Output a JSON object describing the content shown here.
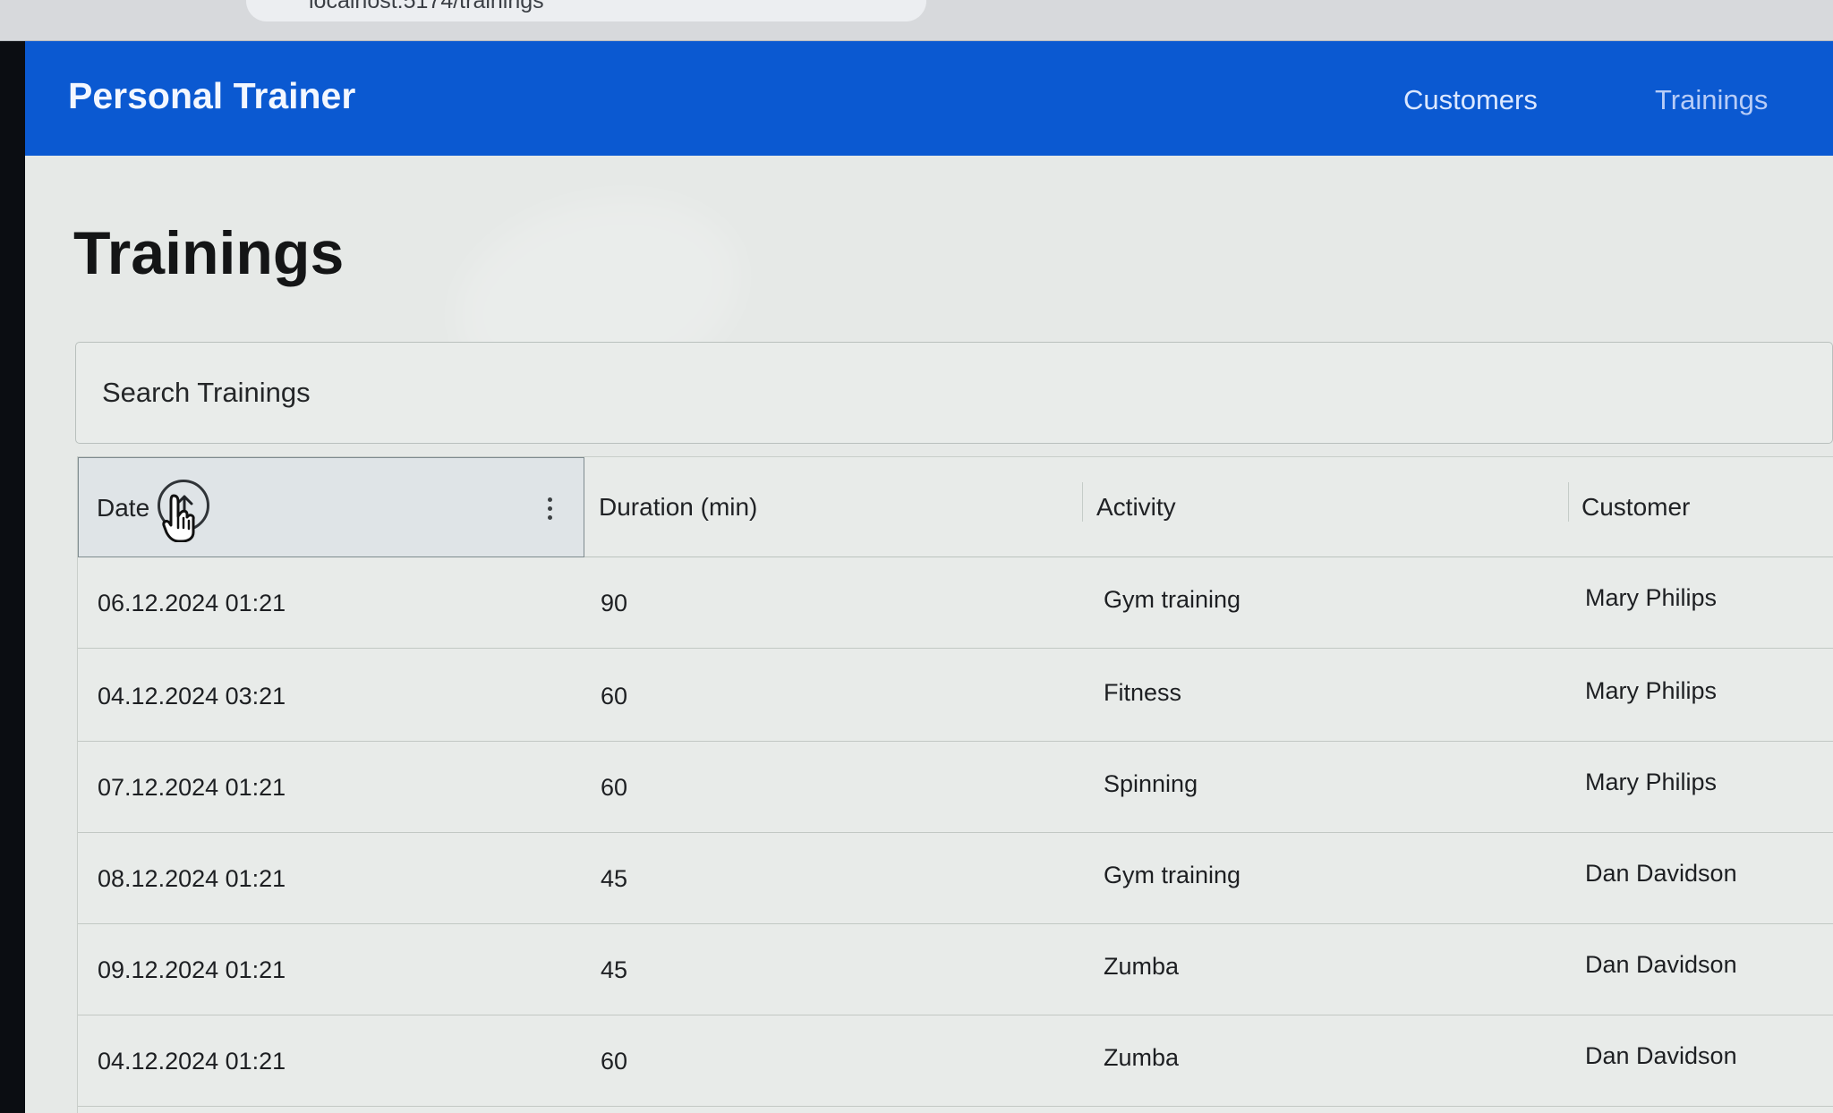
{
  "browser": {
    "url_fragment": "localhost:5174/trainings"
  },
  "topbar": {
    "brand": "Personal Trainer",
    "nav": {
      "customers": "Customers",
      "trainings": "Trainings"
    },
    "colors": {
      "bar": "#0b59d1",
      "text": "#f3f7ff"
    }
  },
  "main": {
    "title": "Trainings",
    "search": {
      "placeholder": "Search Trainings",
      "value": ""
    },
    "table": {
      "columns": [
        "Date",
        "Duration (min)",
        "Activity",
        "Customer"
      ],
      "sort": {
        "column": "Date",
        "direction": "ascending",
        "icon": "arrow-up-icon"
      },
      "rows": [
        {
          "date": "06.12.2024 01:21",
          "duration": "90",
          "activity": "Gym training",
          "customer": "Mary Philips"
        },
        {
          "date": "04.12.2024 03:21",
          "duration": "60",
          "activity": "Fitness",
          "customer": "Mary Philips"
        },
        {
          "date": "07.12.2024 01:21",
          "duration": "60",
          "activity": "Spinning",
          "customer": "Mary Philips"
        },
        {
          "date": "08.12.2024 01:21",
          "duration": "45",
          "activity": "Gym training",
          "customer": "Dan Davidson"
        },
        {
          "date": "09.12.2024 01:21",
          "duration": "45",
          "activity": "Zumba",
          "customer": "Dan Davidson"
        },
        {
          "date": "04.12.2024 01:21",
          "duration": "60",
          "activity": "Zumba",
          "customer": "Dan Davidson"
        }
      ]
    }
  },
  "icons": {
    "sort": "arrow-up-icon",
    "pointer": "hand-pointer-icon",
    "column_menu": "vertical-ellipsis-icon"
  }
}
